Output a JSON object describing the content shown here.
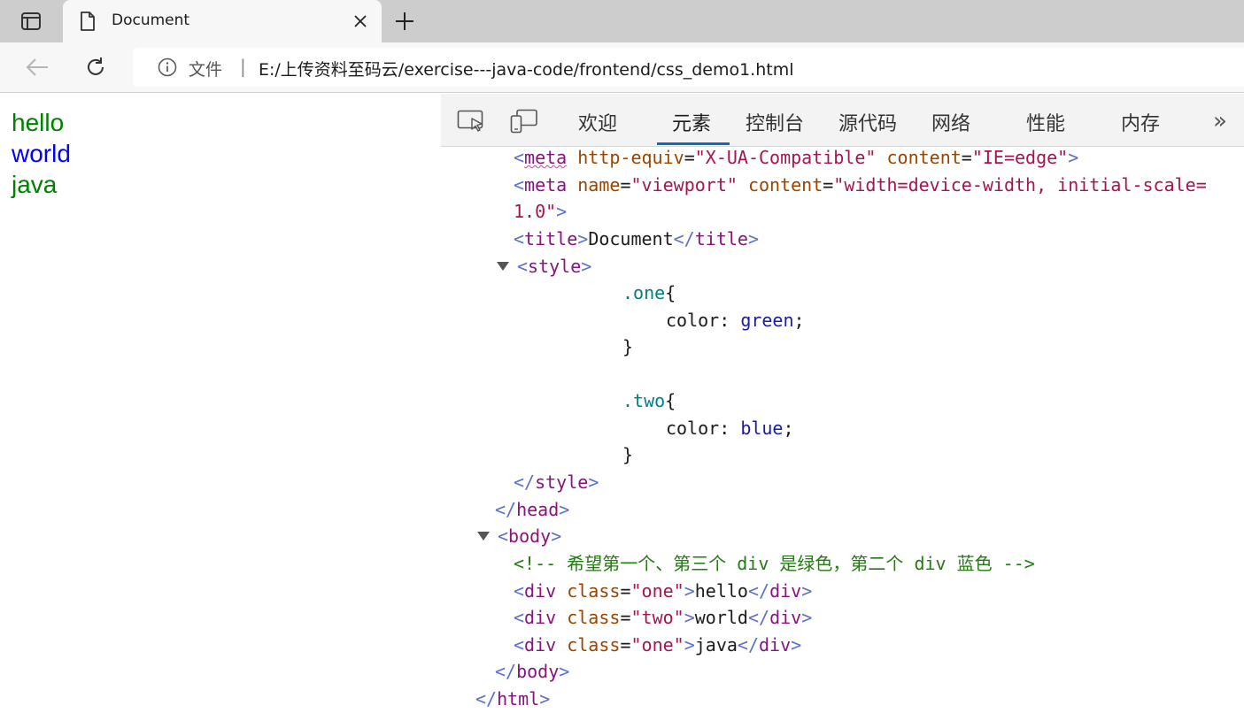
{
  "browser": {
    "tab": {
      "title": "Document"
    },
    "address": {
      "site_label": "文件",
      "separator": "|",
      "url": "E:/上传资料至码云/exercise---java-code/frontend/css_demo1.html"
    }
  },
  "page": {
    "lines": [
      {
        "text": "hello",
        "color": "#008000"
      },
      {
        "text": "world",
        "color": "#0000ff"
      },
      {
        "text": "java",
        "color": "#008000"
      }
    ]
  },
  "devtools": {
    "tabs": [
      {
        "label": "欢迎"
      },
      {
        "label": "元素",
        "active": true
      },
      {
        "label": "控制台"
      },
      {
        "label": "源代码"
      },
      {
        "label": "网络"
      },
      {
        "label": "性能"
      },
      {
        "label": "内存"
      }
    ],
    "more": "»",
    "code": {
      "meta1": {
        "open": "<",
        "tag": "meta",
        "attr1": "http-equiv",
        "val1": "\"X-UA-Compatible\"",
        "attr2": "content",
        "val2": "\"IE=edge\"",
        "close": ">"
      },
      "meta2": {
        "open": "<",
        "tag": "meta",
        "attr1": "name",
        "val1": "\"viewport\"",
        "attr2": "content",
        "val2a": "\"width=device-width, initial-scale=",
        "val2b": "1.0\"",
        "close": ">"
      },
      "title": {
        "open": "<",
        "tag": "title",
        "mid": ">",
        "text": "Document",
        "close_open": "</",
        "close_tag": "title",
        "close": ">"
      },
      "style_open": {
        "open": "<",
        "tag": "style",
        "close": ">"
      },
      "css": {
        "sel1": ".one",
        "brace_open": "{",
        "prop1": "color",
        "colon": ":",
        "val1": "green",
        "semi": ";",
        "brace_close": "}",
        "sel2": ".two",
        "prop2": "color",
        "val2": "blue"
      },
      "style_close": {
        "open": "</",
        "tag": "style",
        "close": ">"
      },
      "head_close": {
        "open": "</",
        "tag": "head",
        "close": ">"
      },
      "body_open": {
        "open": "<",
        "tag": "body",
        "close": ">"
      },
      "comment": "<!-- 希望第一个、第三个 div 是绿色，第二个 div 蓝色 -->",
      "divs": [
        {
          "open": "<",
          "tag": "div",
          "attr": "class",
          "eq": "=",
          "val": "\"one\"",
          "mid": ">",
          "text": "hello",
          "close_open": "</",
          "close_tag": "div",
          "close": ">"
        },
        {
          "open": "<",
          "tag": "div",
          "attr": "class",
          "eq": "=",
          "val": "\"two\"",
          "mid": ">",
          "text": "world",
          "close_open": "</",
          "close_tag": "div",
          "close": ">"
        },
        {
          "open": "<",
          "tag": "div",
          "attr": "class",
          "eq": "=",
          "val": "\"one\"",
          "mid": ">",
          "text": "java",
          "close_open": "</",
          "close_tag": "div",
          "close": ">"
        }
      ],
      "body_close": {
        "open": "</",
        "tag": "body",
        "close": ">"
      },
      "html_close": {
        "open": "</",
        "tag": "html",
        "close": ">"
      },
      "eq": "="
    }
  },
  "colors": {
    "tag": "#881280",
    "bracket": "#5c6fcb",
    "attr": "#994500",
    "attr_value": "#a31551",
    "selector": "#008080",
    "css_value": "#1a1aa6",
    "comment": "#237a12",
    "accent": "#0f6cbd"
  },
  "icons": [
    "tab-actions-icon",
    "document-icon",
    "close-icon",
    "plus-icon",
    "back-arrow-icon",
    "reload-icon",
    "info-icon",
    "inspect-icon",
    "device-emulation-icon",
    "expand-triangle-icon"
  ]
}
